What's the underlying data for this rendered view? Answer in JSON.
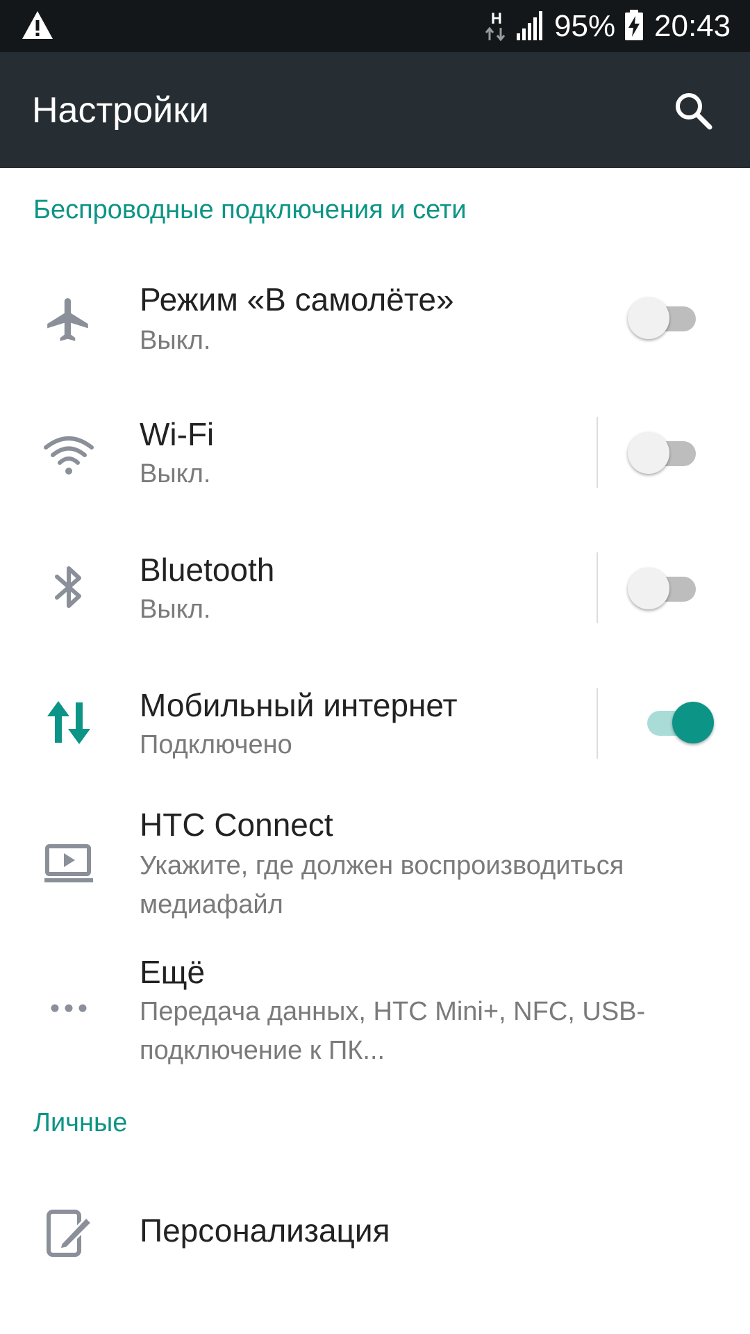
{
  "status_bar": {
    "battery_percent": "95%",
    "time": "20:43",
    "network_type": "H",
    "icons": [
      "warning-icon",
      "network-h-icon",
      "signal-icon",
      "battery-charging-icon"
    ]
  },
  "app_bar": {
    "title": "Настройки",
    "search_icon": "search-icon",
    "background": "#262e33"
  },
  "accent_color": "#0c9486",
  "sections": {
    "wireless": {
      "header": "Беспроводные подключения и сети",
      "items": {
        "airplane": {
          "title": "Режим «В самолёте»",
          "subtitle": "Выкл.",
          "icon": "airplane-icon",
          "switch_on": false
        },
        "wifi": {
          "title": "Wi-Fi",
          "subtitle": "Выкл.",
          "icon": "wifi-icon",
          "switch_on": false
        },
        "bluetooth": {
          "title": "Bluetooth",
          "subtitle": "Выкл.",
          "icon": "bluetooth-icon",
          "switch_on": false
        },
        "mobile": {
          "title": "Мобильный интернет",
          "subtitle": "Подключено",
          "icon": "mobile-data-icon",
          "switch_on": true
        },
        "htc_connect": {
          "title": "HTC Connect",
          "subtitle": "Укажите, где должен воспроизводиться медиафайл",
          "icon": "cast-icon"
        },
        "more": {
          "title": "Ещё",
          "subtitle": "Передача данных, HTC Mini+, NFC, USB-подключение к ПК...",
          "icon": "more-icon"
        }
      }
    },
    "personal": {
      "header": "Личные",
      "items": {
        "personalize": {
          "title": "Персонализация",
          "icon": "personalize-icon"
        }
      }
    }
  }
}
